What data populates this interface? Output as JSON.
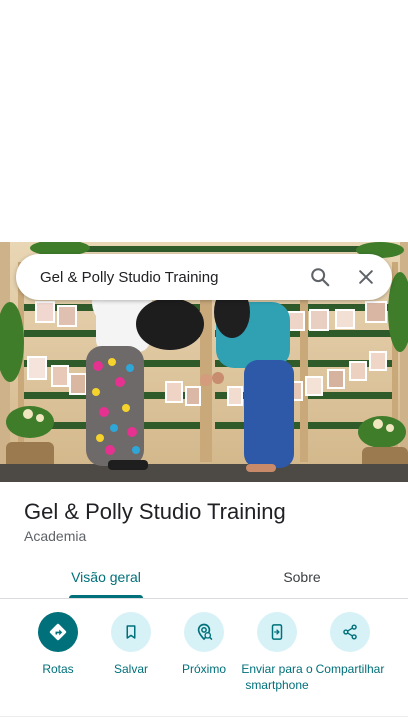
{
  "search": {
    "query": "Gel & Polly Studio Training"
  },
  "place": {
    "name": "Gel & Polly Studio Training",
    "category": "Academia"
  },
  "tabs": [
    {
      "label": "Visão geral",
      "active": true
    },
    {
      "label": "Sobre",
      "active": false
    }
  ],
  "actions": [
    {
      "label": "Rotas",
      "icon": "directions-icon",
      "primary": true
    },
    {
      "label": "Salvar",
      "icon": "bookmark-icon",
      "primary": false
    },
    {
      "label": "Próximo",
      "icon": "nearby-icon",
      "primary": false
    },
    {
      "label": "Enviar para o smartphone",
      "icon": "send-to-phone-icon",
      "primary": false
    },
    {
      "label": "Compartilhar",
      "icon": "share-icon",
      "primary": false
    }
  ],
  "colors": {
    "accent": "#00707a",
    "action_background": "#d7f2f7"
  }
}
